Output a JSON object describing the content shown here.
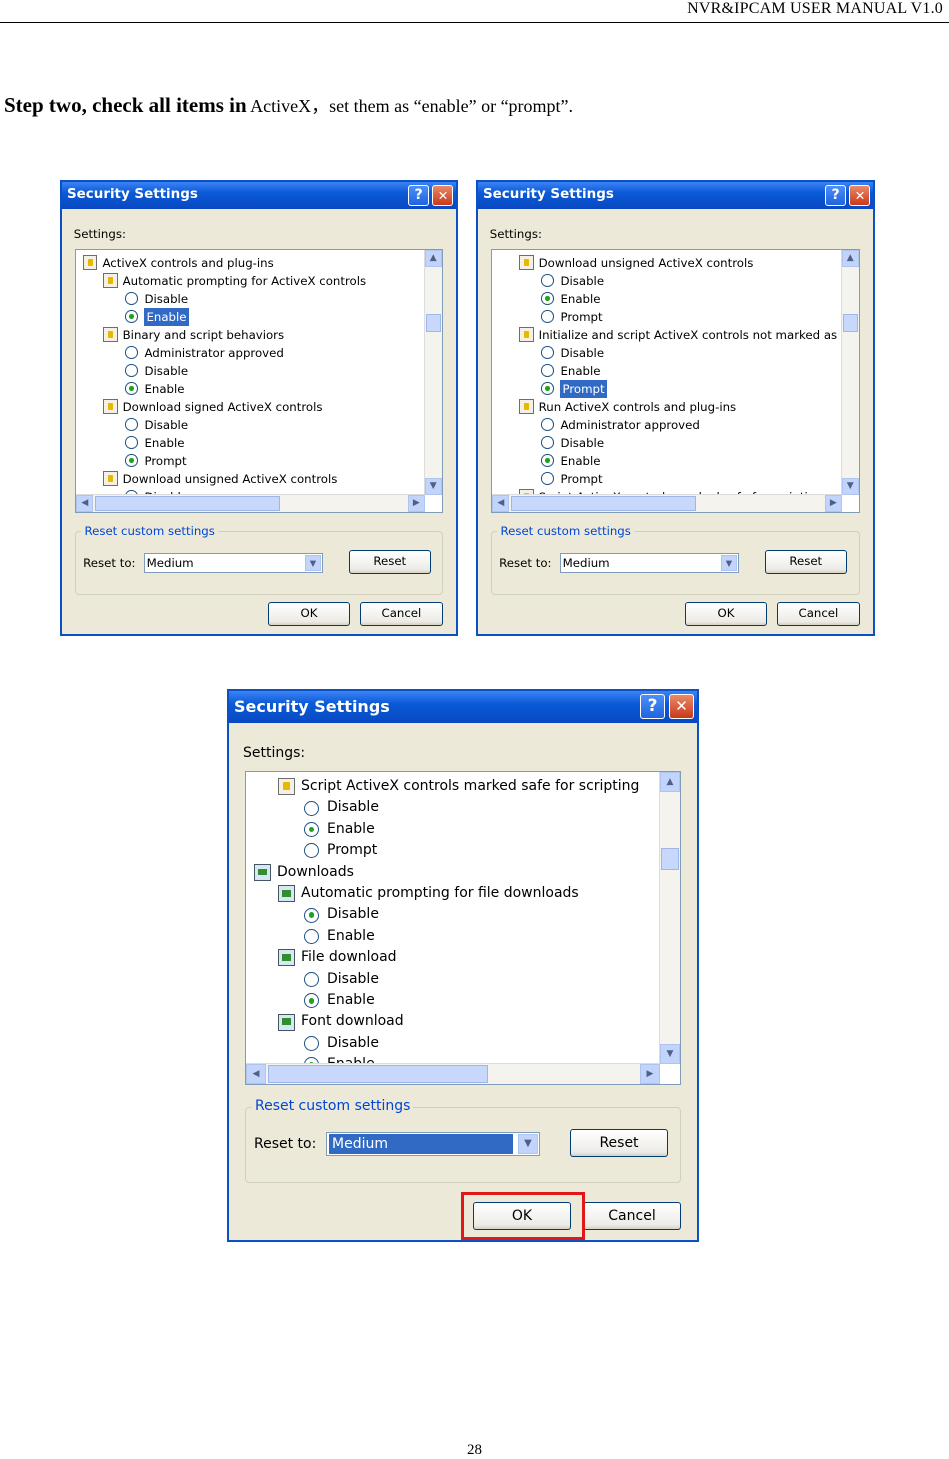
{
  "header": {
    "text": "NVR&IPCAM USER MANUAL V1.0"
  },
  "instruction": {
    "bold": "Step two, check all items in",
    "rest": " ActiveX，set them as “enable” or “prompt”."
  },
  "page_number": "28",
  "colors": {
    "title_bar": "#0a5ad6",
    "dialog_face": "#ece9d8",
    "selection": "#316ac5",
    "highlight_box": "#e01818"
  },
  "dialog_common": {
    "title": "Security Settings",
    "help_glyph": "?",
    "close_glyph": "✕",
    "settings_label": "Settings:",
    "reset_group_label": "Reset custom settings",
    "reset_to_label": "Reset to:",
    "reset_level": "Medium",
    "reset_button": "Reset",
    "ok_button": "OK",
    "cancel_button": "Cancel"
  },
  "dialogs": [
    {
      "items": [
        {
          "level": 0,
          "kind": "cert",
          "text": "ActiveX controls and plug-ins"
        },
        {
          "level": 1,
          "kind": "cert",
          "text": "Automatic prompting for ActiveX controls"
        },
        {
          "level": 2,
          "kind": "radio",
          "text": "Disable",
          "checked": false
        },
        {
          "level": 2,
          "kind": "radio",
          "text": "Enable",
          "checked": true,
          "selected": true
        },
        {
          "level": 1,
          "kind": "cert",
          "text": "Binary and script behaviors"
        },
        {
          "level": 2,
          "kind": "radio",
          "text": "Administrator approved",
          "checked": false
        },
        {
          "level": 2,
          "kind": "radio",
          "text": "Disable",
          "checked": false
        },
        {
          "level": 2,
          "kind": "radio",
          "text": "Enable",
          "checked": true
        },
        {
          "level": 1,
          "kind": "cert",
          "text": "Download signed ActiveX controls"
        },
        {
          "level": 2,
          "kind": "radio",
          "text": "Disable",
          "checked": false
        },
        {
          "level": 2,
          "kind": "radio",
          "text": "Enable",
          "checked": false
        },
        {
          "level": 2,
          "kind": "radio",
          "text": "Prompt",
          "checked": true
        },
        {
          "level": 1,
          "kind": "cert",
          "text": "Download unsigned ActiveX controls"
        },
        {
          "level": 2,
          "kind": "radio",
          "text": "Disable",
          "checked": false
        }
      ]
    },
    {
      "items": [
        {
          "level": 1,
          "kind": "cert",
          "text": "Download unsigned ActiveX controls"
        },
        {
          "level": 2,
          "kind": "radio",
          "text": "Disable",
          "checked": false
        },
        {
          "level": 2,
          "kind": "radio",
          "text": "Enable",
          "checked": true
        },
        {
          "level": 2,
          "kind": "radio",
          "text": "Prompt",
          "checked": false
        },
        {
          "level": 1,
          "kind": "cert",
          "text": "Initialize and script ActiveX controls not marked as safe"
        },
        {
          "level": 2,
          "kind": "radio",
          "text": "Disable",
          "checked": false
        },
        {
          "level": 2,
          "kind": "radio",
          "text": "Enable",
          "checked": false
        },
        {
          "level": 2,
          "kind": "radio",
          "text": "Prompt",
          "checked": true,
          "selected": true
        },
        {
          "level": 1,
          "kind": "cert",
          "text": "Run ActiveX controls and plug-ins"
        },
        {
          "level": 2,
          "kind": "radio",
          "text": "Administrator approved",
          "checked": false
        },
        {
          "level": 2,
          "kind": "radio",
          "text": "Disable",
          "checked": false
        },
        {
          "level": 2,
          "kind": "radio",
          "text": "Enable",
          "checked": true
        },
        {
          "level": 2,
          "kind": "radio",
          "text": "Prompt",
          "checked": false
        },
        {
          "level": 1,
          "kind": "cert",
          "text": "Script ActiveX controls marked safe for scripting"
        }
      ]
    },
    {
      "items": [
        {
          "level": 1,
          "kind": "cert",
          "text": "Script ActiveX controls marked safe for scripting"
        },
        {
          "level": 2,
          "kind": "radio",
          "text": "Disable",
          "checked": false
        },
        {
          "level": 2,
          "kind": "radio",
          "text": "Enable",
          "checked": true
        },
        {
          "level": 2,
          "kind": "radio",
          "text": "Prompt",
          "checked": false
        },
        {
          "level": 0,
          "kind": "download",
          "text": "Downloads"
        },
        {
          "level": 1,
          "kind": "download",
          "text": "Automatic prompting for file downloads"
        },
        {
          "level": 2,
          "kind": "radio",
          "text": "Disable",
          "checked": true
        },
        {
          "level": 2,
          "kind": "radio",
          "text": "Enable",
          "checked": false
        },
        {
          "level": 1,
          "kind": "download",
          "text": "File download"
        },
        {
          "level": 2,
          "kind": "radio",
          "text": "Disable",
          "checked": false
        },
        {
          "level": 2,
          "kind": "radio",
          "text": "Enable",
          "checked": true
        },
        {
          "level": 1,
          "kind": "download",
          "text": "Font download"
        },
        {
          "level": 2,
          "kind": "radio",
          "text": "Disable",
          "checked": false
        },
        {
          "level": 2,
          "kind": "radio",
          "text": "Enable",
          "checked": true
        }
      ]
    }
  ]
}
